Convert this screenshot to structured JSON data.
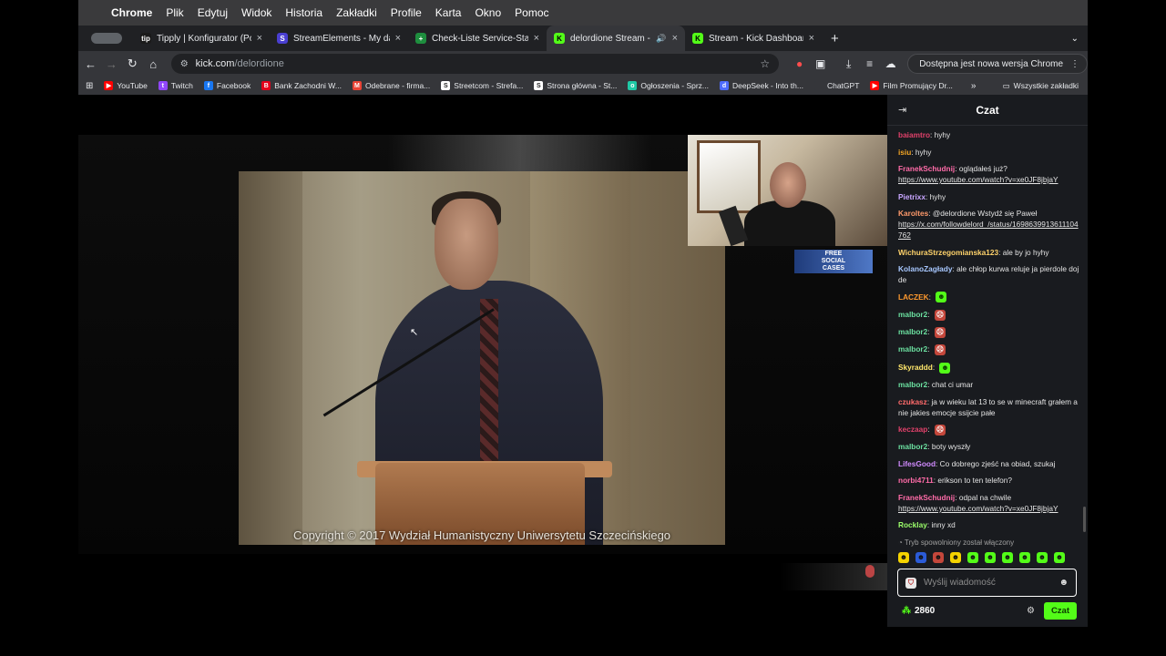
{
  "menubar": {
    "app": "Chrome",
    "items": [
      "Plik",
      "Edytuj",
      "Widok",
      "Historia",
      "Zakładki",
      "Profile",
      "Karta",
      "Okno",
      "Pomoc"
    ]
  },
  "tabs": [
    {
      "title": "Tipply | Konfigurator (Powiad",
      "favicon": "tipply-icon",
      "color": "#1a1a1a",
      "glyph": "tip"
    },
    {
      "title": "StreamElements - My dashbo",
      "favicon": "streamelements-icon",
      "color": "#4a3fd1",
      "glyph": "S"
    },
    {
      "title": "Check-Liste Service-Start-Al",
      "favicon": "sheets-icon",
      "color": "#1e8e3e",
      "glyph": "+"
    },
    {
      "title": "delordione Stream - Watc",
      "favicon": "kick-icon",
      "color": "#53fc18",
      "glyph": "K",
      "active": true,
      "audio": true
    },
    {
      "title": "Stream - Kick Dashboard",
      "favicon": "kick-icon",
      "color": "#53fc18",
      "glyph": "K"
    }
  ],
  "toolbar": {
    "url_host": "kick.com",
    "url_path": "/delordione",
    "update_label": "Dostępna jest nowa wersja Chrome"
  },
  "bookmarks": [
    {
      "label": "YouTube",
      "color": "#ff0000",
      "glyph": "▶"
    },
    {
      "label": "Twitch",
      "color": "#9146ff",
      "glyph": "t"
    },
    {
      "label": "Facebook",
      "color": "#1877f2",
      "glyph": "f"
    },
    {
      "label": "Bank Zachodni W...",
      "color": "#e3001b",
      "glyph": "B"
    },
    {
      "label": "Odebrane - firma...",
      "color": "#ea4335",
      "glyph": "M"
    },
    {
      "label": "Streetcom - Strefa...",
      "color": "#ffffff",
      "glyph": "S"
    },
    {
      "label": "Strona główna - St...",
      "color": "#ffffff",
      "glyph": "S"
    },
    {
      "label": "Ogłoszenia - Sprz...",
      "color": "#1fc9a6",
      "glyph": "o"
    },
    {
      "label": "DeepSeek - Into th...",
      "color": "#4d6bfe",
      "glyph": "d"
    },
    {
      "label": "ChatGPT",
      "color": "#35363a",
      "glyph": ""
    },
    {
      "label": "Film Promujący Dr...",
      "color": "#ff0000",
      "glyph": "▶"
    }
  ],
  "bookmarks_all": "Wszystkie zakładki",
  "video": {
    "copyright": "Copyright © 2017 Wydział Humanistyczny Uniwersytetu Szczecińskiego",
    "badge_line1": "FREE",
    "badge_line2": "SOCIAL",
    "badge_line3": "CASES"
  },
  "chat": {
    "title": "Czat",
    "messages": [
      {
        "user": "baiamtro",
        "color": "#e0416a",
        "text": "hyhy"
      },
      {
        "user": "isiu",
        "color": "#f5a623",
        "text": "hyhy"
      },
      {
        "user": "FranekSchudnij",
        "color": "#ff6ba8",
        "text": "oglądałeś już?",
        "link": "https://www.youtube.com/watch?v=xe0JF8jbjaY"
      },
      {
        "user": "Pietrixx",
        "color": "#c8a6ff",
        "text": "hyhy"
      },
      {
        "user": "Karoltes",
        "color": "#ff9a6b",
        "text": "@delordione Wstydź się Paweł",
        "link": "https://x.com/followdelord_/status/1698639913611104762"
      },
      {
        "user": "WichuraStrzegomianska123",
        "color": "#ffd36b",
        "text": "ale by jo hyhy"
      },
      {
        "user": "KolanoZagłady",
        "color": "#a8c8ff",
        "text": "ale chłop kurwa reluje ja pierdole dojde"
      },
      {
        "user": "LACZEK",
        "color": "#ff9a2e",
        "text": "",
        "emote": "green"
      },
      {
        "user": "malbor2",
        "color": "#6be0a0",
        "text": "",
        "emote": "red"
      },
      {
        "user": "malbor2",
        "color": "#6be0a0",
        "text": "",
        "emote": "red"
      },
      {
        "user": "malbor2",
        "color": "#6be0a0",
        "text": "",
        "emote": "red"
      },
      {
        "user": "Skyraddd",
        "color": "#ffe66b",
        "text": "",
        "emote": "green"
      },
      {
        "user": "malbor2",
        "color": "#6be0a0",
        "text": "chat ci umar"
      },
      {
        "user": "czukasz",
        "color": "#ff6b6b",
        "text": "ja w wieku lat 13 to se w minecraft grałem a nie jakies emocje ssijcie pałe"
      },
      {
        "user": "keczaap",
        "color": "#e0416a",
        "text": "",
        "emote": "red"
      },
      {
        "user": "malbor2",
        "color": "#6be0a0",
        "text": "boty wyszły"
      },
      {
        "user": "LifesGood",
        "color": "#d18bff",
        "text": "Co dobrego zjeść na obiad, szukaj"
      },
      {
        "user": "norbi4711",
        "color": "#ff6ba8",
        "text": "erikson to ten telefon?"
      },
      {
        "user": "FranekSchudnij",
        "color": "#ff6ba8",
        "text": "odpal na chwile",
        "link": "https://www.youtube.com/watch?v=xe0JF8jbjaY"
      },
      {
        "user": "Rocklay",
        "color": "#9cff6b",
        "text": "inny xd"
      }
    ],
    "slow_mode": "Tryb spowolniony został włączony",
    "input_placeholder": "Wyślij wiadomość",
    "points": "2860",
    "send_label": "Czat"
  }
}
